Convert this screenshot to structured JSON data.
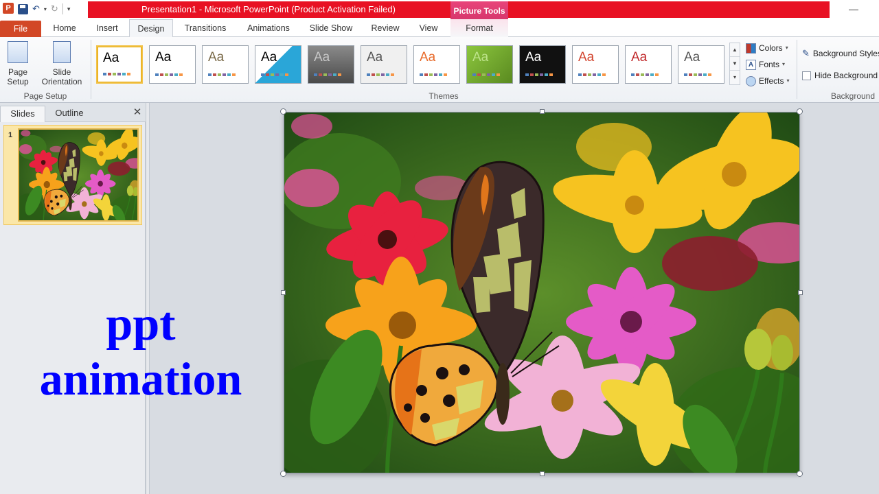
{
  "window": {
    "app_icon": "P",
    "title": "Presentation1  -  Microsoft PowerPoint (Product Activation Failed)",
    "context_tab": "Picture Tools",
    "minimize_glyph": "—"
  },
  "tabs": [
    {
      "label": "File"
    },
    {
      "label": "Home"
    },
    {
      "label": "Insert"
    },
    {
      "label": "Design"
    },
    {
      "label": "Transitions"
    },
    {
      "label": "Animations"
    },
    {
      "label": "Slide Show"
    },
    {
      "label": "Review"
    },
    {
      "label": "View"
    },
    {
      "label": "Format"
    }
  ],
  "page_setup": {
    "page_setup_label": "Page\nSetup",
    "orientation_label": "Slide\nOrientation",
    "orientation_caret": "▾",
    "group_label": "Page Setup"
  },
  "themes": {
    "group_label": "Themes",
    "items": [
      {
        "text": "Aa",
        "name": "theme-office",
        "bg": "#ffffff",
        "fg": "#000000"
      },
      {
        "text": "Aa",
        "name": "theme-2",
        "bg": "#ffffff",
        "fg": "#000000"
      },
      {
        "text": "Aa",
        "name": "theme-3",
        "bg": "#ffffff",
        "fg": "#7a6a48"
      },
      {
        "text": "Aa",
        "name": "theme-4",
        "bg": "#2aa6d8",
        "fg": "#000000"
      },
      {
        "text": "Aa",
        "name": "theme-5",
        "bg": "#6a6a6a",
        "fg": "#c8c8c8"
      },
      {
        "text": "Aa",
        "name": "theme-6",
        "bg": "#f0f0f0",
        "fg": "#555555"
      },
      {
        "text": "Aa",
        "name": "theme-7",
        "bg": "#ffffff",
        "fg": "#e86a2a"
      },
      {
        "text": "Aa",
        "name": "theme-8",
        "bg": "#8cc63e",
        "fg": "#bde38a"
      },
      {
        "text": "Aa",
        "name": "theme-9",
        "bg": "#111111",
        "fg": "#ffffff"
      },
      {
        "text": "Aa",
        "name": "theme-10",
        "bg": "#ffffff",
        "fg": "#d2452f"
      },
      {
        "text": "Aa",
        "name": "theme-11",
        "bg": "#ffffff",
        "fg": "#c0282a"
      },
      {
        "text": "Aa",
        "name": "theme-12",
        "bg": "#ffffff",
        "fg": "#555555"
      }
    ]
  },
  "theme_options": {
    "colors": "Colors",
    "fonts": "Fonts",
    "effects": "Effects",
    "caret": "▾"
  },
  "background": {
    "styles": "Background Styles",
    "hide_graphics": "Hide Background Graphics",
    "group_label": "Background"
  },
  "pane": {
    "tab_slides": "Slides",
    "tab_outline": "Outline",
    "close_glyph": "✕",
    "slide_number": "1"
  },
  "overlay": {
    "line1": "ppt",
    "line2": "animation"
  },
  "colors": {
    "title_bar_red": "#e81123",
    "file_tab": "#d24726",
    "picture_tools": "#e8447a",
    "overlay_text": "#0000ff",
    "selection_gold": "#f2c34c"
  }
}
